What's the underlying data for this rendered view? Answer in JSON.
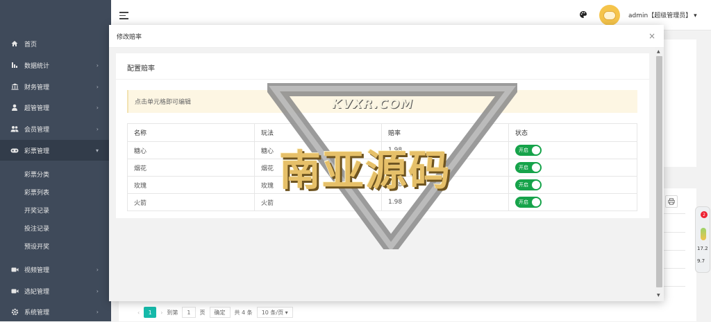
{
  "sidebar": {
    "items": [
      {
        "label": "首页",
        "icon": "home-icon",
        "arrow": false
      },
      {
        "label": "数据统计",
        "icon": "bar-chart-icon",
        "arrow": true
      },
      {
        "label": "财务管理",
        "icon": "bank-icon",
        "arrow": true
      },
      {
        "label": "超管管理",
        "icon": "user-icon",
        "arrow": true
      },
      {
        "label": "会员管理",
        "icon": "group-icon",
        "arrow": true
      },
      {
        "label": "彩票管理",
        "icon": "gamepad-icon",
        "arrow": true,
        "expanded": true
      }
    ],
    "subitems": [
      "彩票分类",
      "彩票列表",
      "开奖记录",
      "投注记录",
      "预设开奖"
    ],
    "items_bottom": [
      {
        "label": "视频管理",
        "icon": "video-icon",
        "arrow": true
      },
      {
        "label": "选妃管理",
        "icon": "video-icon",
        "arrow": true
      },
      {
        "label": "系统管理",
        "icon": "gear-icon",
        "arrow": true
      }
    ]
  },
  "header": {
    "user": "admin【超级管理员】",
    "caret": "▾"
  },
  "pager": {
    "prev": "‹",
    "page": "1",
    "next": "›",
    "goto_label": "到第",
    "goto_value": "1",
    "page_unit": "页",
    "confirm": "确定",
    "total": "共 4 条",
    "page_size": "10 条/页"
  },
  "float_widget": {
    "badge": "2",
    "up": "17.2",
    "down": "9.7"
  },
  "modal": {
    "title": "修改赔率",
    "close": "×",
    "card_title": "配置赔率",
    "notice": "点击单元格即可编辑",
    "columns": [
      "名称",
      "玩法",
      "赔率",
      "状态"
    ],
    "rows": [
      {
        "name": "糖心",
        "play": "糖心",
        "rate": "1.98",
        "status": "开启"
      },
      {
        "name": "烟花",
        "play": "烟花",
        "rate": "1.98",
        "status": "开启"
      },
      {
        "name": "玫瑰",
        "play": "玫瑰",
        "rate": "1.98",
        "status": "开启"
      },
      {
        "name": "火箭",
        "play": "火箭",
        "rate": "1.98",
        "status": "开启"
      }
    ]
  },
  "watermark": {
    "url": "KVXR.COM",
    "text": "南亚源码"
  },
  "colors": {
    "sidebar_bg": "#3f4a5a",
    "accent": "#16baaa",
    "toggle_on": "#16a34a",
    "notice_bg": "#fdf6e3"
  }
}
